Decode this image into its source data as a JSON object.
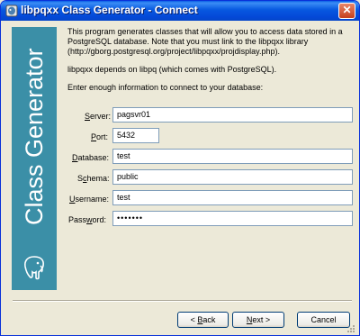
{
  "window": {
    "title": "libpqxx Class Generator - Connect",
    "close_label": "✕"
  },
  "banner": {
    "text": "Class Generator",
    "logo_icon": "postgresql-elephant-icon",
    "color": "#3b8fa7"
  },
  "intro": {
    "paragraph1": "This program generates classes that will allow you to access data stored in a PostgreSQL database. Note that you must link to the libpqxx library (http://gborg.postgresql.org/project/libpqxx/projdisplay.php).",
    "paragraph2": "libpqxx depends on libpq (which comes with PostgreSQL).",
    "paragraph3": "Enter enough information to connect to your database:"
  },
  "fields": {
    "server": {
      "label_pre": "",
      "label_key": "S",
      "label_post": "erver:",
      "value": "pagsvr01"
    },
    "port": {
      "label_pre": "",
      "label_key": "P",
      "label_post": "ort:",
      "value": "5432"
    },
    "database": {
      "label_pre": "",
      "label_key": "D",
      "label_post": "atabase:",
      "value": "test"
    },
    "schema": {
      "label_pre": "S",
      "label_key": "c",
      "label_post": "hema:",
      "value": "public"
    },
    "username": {
      "label_pre": "",
      "label_key": "U",
      "label_post": "sername:",
      "value": "test"
    },
    "password": {
      "label_pre": "Pass",
      "label_key": "w",
      "label_post": "ord:",
      "value": "•••••••"
    }
  },
  "buttons": {
    "back": {
      "prefix": "< ",
      "key": "B",
      "rest": "ack"
    },
    "next": {
      "prefix": "",
      "key": "N",
      "rest": "ext >"
    },
    "cancel": {
      "label": "Cancel"
    }
  }
}
